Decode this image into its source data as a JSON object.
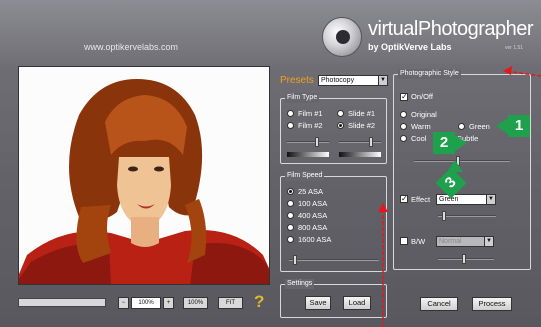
{
  "header": {
    "url": "www.optikervelabs.com",
    "brand_title": "virtualPhotographer",
    "brand_subtitle": "by OptikVerve Labs",
    "version": "ver 1.51"
  },
  "presets": {
    "label": "Presets",
    "value": "Photocopy"
  },
  "film_type": {
    "title": "Film Type",
    "options": [
      "Film #1",
      "Slide #1",
      "Film #2",
      "Slide #2"
    ],
    "selected": "Slide #2"
  },
  "film_speed": {
    "title": "Film Speed",
    "options": [
      "25 ASA",
      "100 ASA",
      "400 ASA",
      "800 ASA",
      "1600 ASA"
    ],
    "selected": "25 ASA"
  },
  "settings": {
    "title": "Settings",
    "save": "Save",
    "load": "Load"
  },
  "style": {
    "title": "Photographic Style",
    "on_off": "On/Off",
    "on_off_checked": true,
    "options": [
      "Original",
      "Warm",
      "Green",
      "Cool",
      "Subtle"
    ],
    "selected": "Subtle",
    "effect_label": "Effect",
    "effect_checked": true,
    "effect_value": "Green",
    "bw_label": "B/W",
    "bw_checked": false,
    "bw_value": "Normal"
  },
  "zoom": {
    "minus": "−",
    "value": "100%",
    "plus": "+",
    "full": "100%",
    "fit": "FIT",
    "help": "?"
  },
  "actions": {
    "cancel": "Cancel",
    "process": "Process"
  },
  "callouts": [
    "1",
    "2",
    "3"
  ],
  "colors": {
    "callout": "#1ea04c",
    "arrow": "#e8141e",
    "preset_label": "#f0a020"
  }
}
